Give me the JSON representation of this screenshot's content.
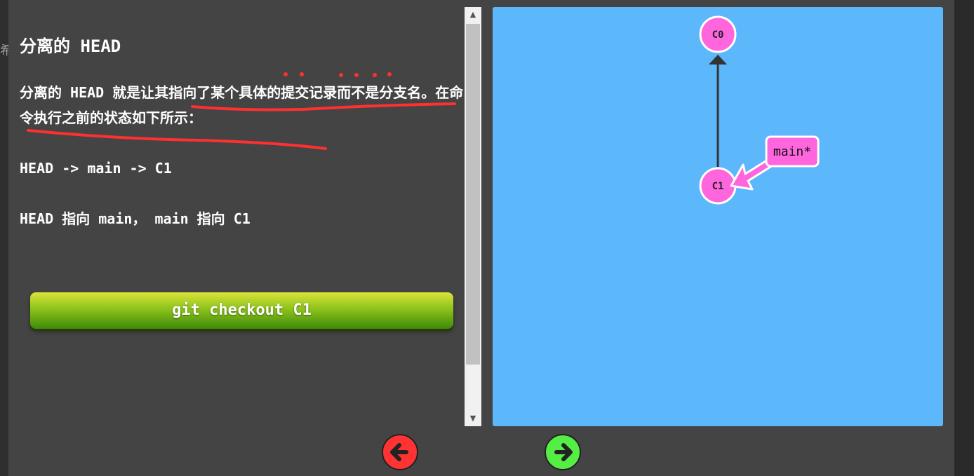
{
  "lesson": {
    "heading": "分离的 HEAD",
    "paragraph1": "分离的 HEAD 就是让其指向了某个具体的提交记录而不是分支名。在命令执行之前的状态如下所示：",
    "paragraph2": "HEAD -> main -> C1",
    "paragraph3": "HEAD 指向 main， main 指向 C1",
    "command_button": "git checkout C1"
  },
  "sidebar_glyph": "希",
  "tree": {
    "commits": [
      {
        "id": "C0",
        "label": "C0"
      },
      {
        "id": "C1",
        "label": "C1"
      }
    ],
    "branches": [
      {
        "name": "main",
        "label": "main*",
        "target": "C1"
      }
    ]
  },
  "navigation": {
    "prev_icon": "arrow-left-icon",
    "next_icon": "arrow-right-icon"
  },
  "colors": {
    "viz_background": "#5cb8fb",
    "commit_fill": "#ff66dd",
    "annotation": "#ff3030",
    "prev_button": "#ff3333",
    "next_button": "#55ee44",
    "command_button_gradient": [
      "#dbe43a",
      "#3f8a0a"
    ]
  }
}
